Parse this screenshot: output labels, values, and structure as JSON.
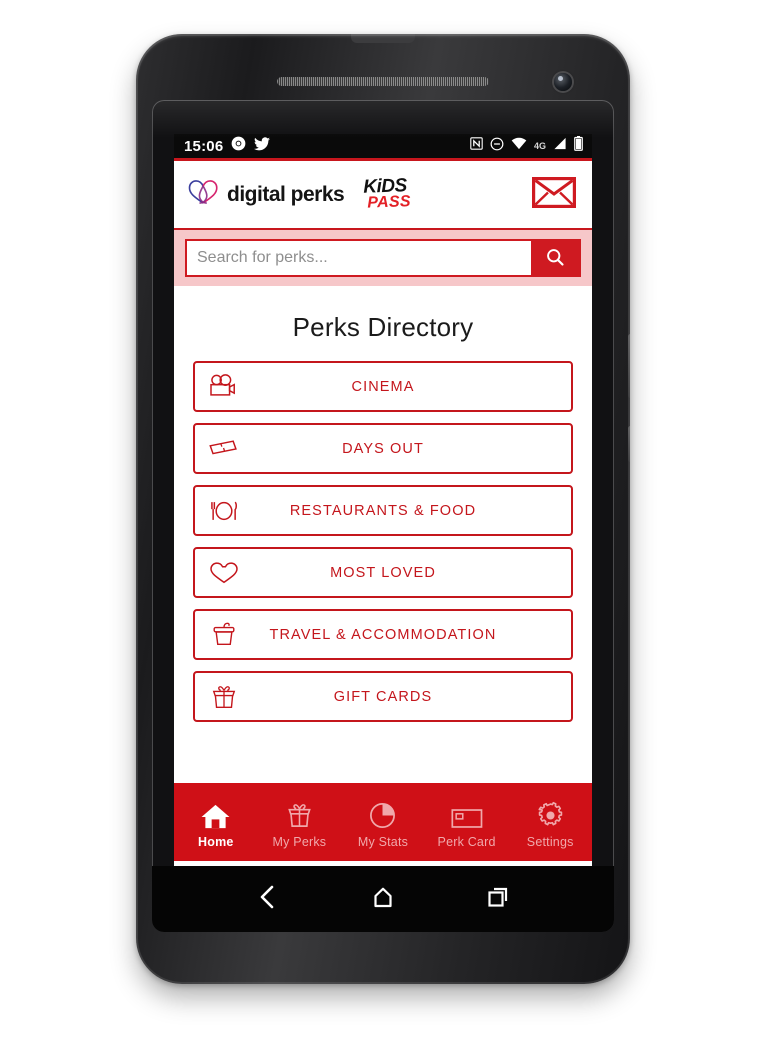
{
  "device": {
    "type": "android-smartphone",
    "frame_color": "#262628"
  },
  "statusbar": {
    "time": "15:06",
    "left_icons": [
      "chrome-icon",
      "twitter-icon"
    ],
    "right_icons": [
      "nfc-icon",
      "do-not-disturb-icon",
      "wifi-icon",
      "signal-icon",
      "battery-icon"
    ],
    "network_label": "4G",
    "background": "#0a0a0a"
  },
  "header": {
    "brand_logo_icon": "digital-perks-heart-logo",
    "brand_name": "digital perks",
    "partner_logo": {
      "line1": "KiDS",
      "line2": "PASS"
    },
    "mail_icon": "envelope-icon",
    "accent_color": "#c8161d"
  },
  "search": {
    "placeholder": "Search for perks...",
    "value": "",
    "button_icon": "search-icon",
    "band_color": "#f6c7c9",
    "button_color": "#cf1a21"
  },
  "main": {
    "title": "Perks Directory",
    "categories": [
      {
        "label": "CINEMA",
        "icon": "film-camera-icon"
      },
      {
        "label": "DAYS OUT",
        "icon": "ticket-icon"
      },
      {
        "label": "RESTAURANTS & FOOD",
        "icon": "plate-cutlery-icon"
      },
      {
        "label": "MOST LOVED",
        "icon": "heart-icon"
      },
      {
        "label": "TRAVEL & ACCOMMODATION",
        "icon": "bucket-icon"
      },
      {
        "label": "GIFT CARDS",
        "icon": "gift-box-icon"
      }
    ],
    "category_color": "#c4161c"
  },
  "tabbar": {
    "background": "#cf1017",
    "active_index": 0,
    "tabs": [
      {
        "label": "Home",
        "icon": "home-icon",
        "active": true
      },
      {
        "label": "My Perks",
        "icon": "gift-icon",
        "active": false
      },
      {
        "label": "My Stats",
        "icon": "pie-chart-icon",
        "active": false
      },
      {
        "label": "Perk Card",
        "icon": "card-icon",
        "active": false
      },
      {
        "label": "Settings",
        "icon": "gear-icon",
        "active": false
      }
    ]
  },
  "navbar": {
    "buttons": [
      {
        "name": "back",
        "icon": "chevron-left-icon"
      },
      {
        "name": "home",
        "icon": "home-outline-icon"
      },
      {
        "name": "recents",
        "icon": "recents-squares-icon"
      }
    ]
  }
}
